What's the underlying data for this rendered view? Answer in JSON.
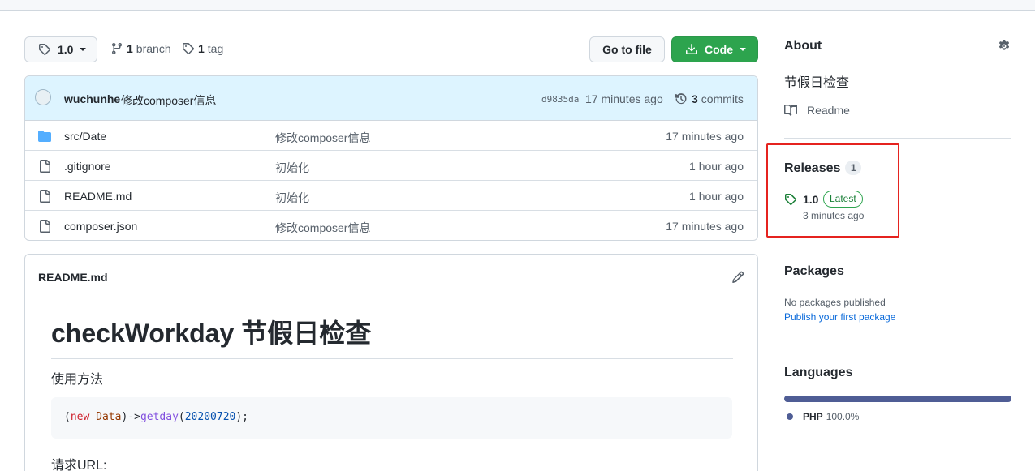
{
  "repo_controls": {
    "branch_selected": "1.0",
    "branch_count": "1",
    "branch_label": "branch",
    "tag_count": "1",
    "tag_label": "tag",
    "goto_file_label": "Go to file",
    "code_label": "Code"
  },
  "latest_commit": {
    "author": "wuchunhe",
    "message": "修改composer信息",
    "sha": "d9835da",
    "time": "17 minutes ago",
    "commit_count": "3",
    "commit_label": "commits"
  },
  "files": [
    {
      "name": "src/Date",
      "type": "folder",
      "message": "修改composer信息",
      "time": "17 minutes ago"
    },
    {
      "name": ".gitignore",
      "type": "file",
      "message": "初始化",
      "time": "1 hour ago"
    },
    {
      "name": "README.md",
      "type": "file",
      "message": "初始化",
      "time": "1 hour ago"
    },
    {
      "name": "composer.json",
      "type": "file",
      "message": "修改composer信息",
      "time": "17 minutes ago"
    }
  ],
  "readme": {
    "filename": "README.md",
    "heading": "checkWorkday 节假日检查",
    "para1": "使用方法",
    "code": {
      "p_open": "(",
      "kw": "new",
      "cls": "Data",
      "arrow": ")->",
      "fn": "getday",
      "p2": "(",
      "num": "20200720",
      "tail": ");"
    },
    "para2": "请求URL:"
  },
  "sidebar": {
    "about_title": "About",
    "description": "节假日检查",
    "readme_label": "Readme",
    "releases_title": "Releases",
    "releases_count": "1",
    "release_version": "1.0",
    "release_badge": "Latest",
    "release_time": "3 minutes ago",
    "packages_title": "Packages",
    "packages_none": "No packages published",
    "packages_link": "Publish your first package",
    "languages_title": "Languages",
    "languages": [
      {
        "name": "PHP",
        "percent": "100.0%",
        "share": 1.0,
        "color": "#4f5d95"
      }
    ]
  },
  "colors": {
    "code_button": "#2da44e",
    "commit_bar": "#ddf4ff",
    "highlight_box": "#e5231f",
    "link": "#0969da"
  }
}
